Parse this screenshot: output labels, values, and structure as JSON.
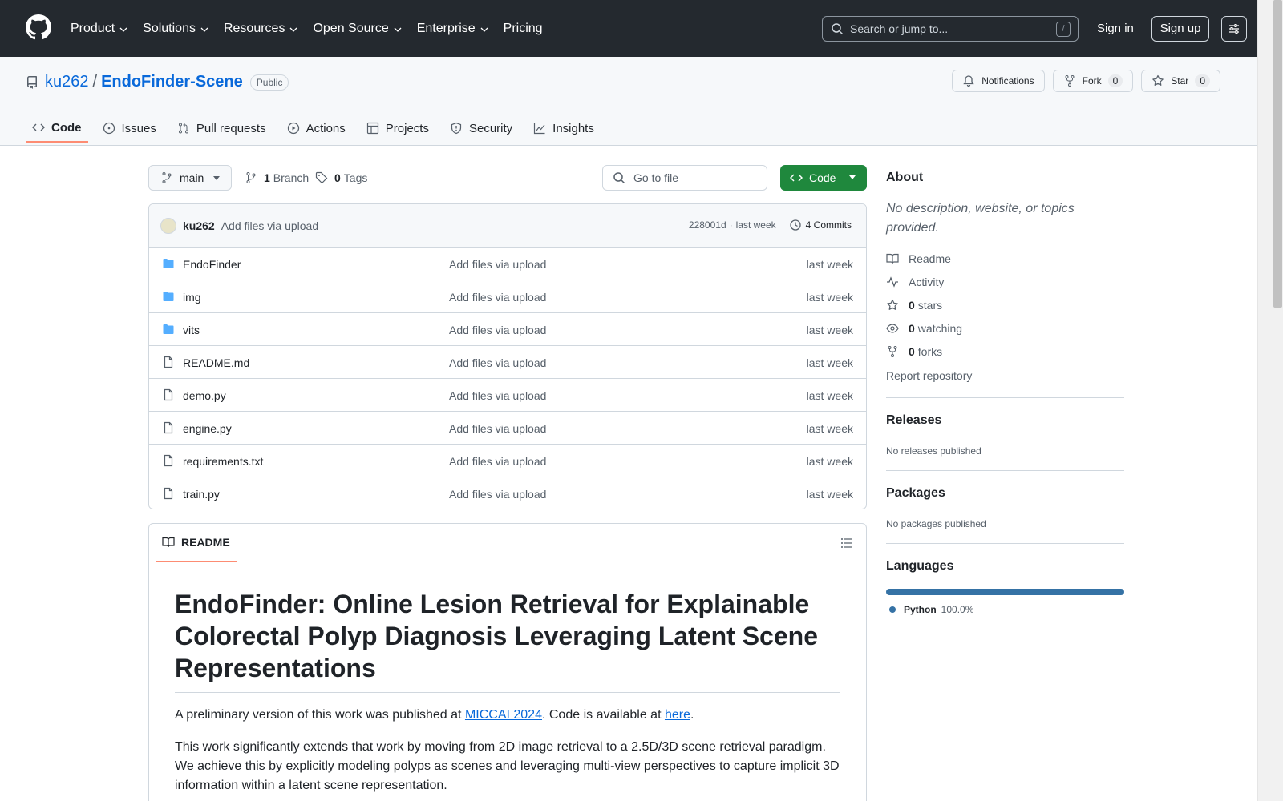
{
  "header": {
    "nav": [
      {
        "label": "Product",
        "has_caret": true
      },
      {
        "label": "Solutions",
        "has_caret": true
      },
      {
        "label": "Resources",
        "has_caret": true
      },
      {
        "label": "Open Source",
        "has_caret": true
      },
      {
        "label": "Enterprise",
        "has_caret": true
      },
      {
        "label": "Pricing",
        "has_caret": false
      }
    ],
    "search_placeholder": "Search or jump to...",
    "search_shortcut": "/",
    "signin": "Sign in",
    "signup": "Sign up"
  },
  "repo": {
    "owner": "ku262",
    "separator": "/",
    "name": "EndoFinder-Scene",
    "visibility": "Public",
    "notifications": "Notifications",
    "fork_label": "Fork",
    "fork_count": "0",
    "star_label": "Star",
    "star_count": "0"
  },
  "tabs": [
    {
      "label": "Code",
      "icon": "code-icon",
      "active": true
    },
    {
      "label": "Issues",
      "icon": "issue-icon",
      "active": false
    },
    {
      "label": "Pull requests",
      "icon": "pull-request-icon",
      "active": false
    },
    {
      "label": "Actions",
      "icon": "play-icon",
      "active": false
    },
    {
      "label": "Projects",
      "icon": "table-icon",
      "active": false
    },
    {
      "label": "Security",
      "icon": "shield-icon",
      "active": false
    },
    {
      "label": "Insights",
      "icon": "graph-icon",
      "active": false
    }
  ],
  "toolbar": {
    "branch": "main",
    "branch_count": "1",
    "branch_label": "Branch",
    "tag_count": "0",
    "tag_label": "Tags",
    "goto_placeholder": "Go to file",
    "code_button": "Code"
  },
  "commit": {
    "author": "ku262",
    "message": "Add files via upload",
    "hash": "228001d",
    "dot": "·",
    "time": "last week",
    "commits": "4 Commits"
  },
  "files": [
    {
      "name": "EndoFinder",
      "type": "dir",
      "message": "Add files via upload",
      "date": "last week"
    },
    {
      "name": "img",
      "type": "dir",
      "message": "Add files via upload",
      "date": "last week"
    },
    {
      "name": "vits",
      "type": "dir",
      "message": "Add files via upload",
      "date": "last week"
    },
    {
      "name": "README.md",
      "type": "file",
      "message": "Add files via upload",
      "date": "last week"
    },
    {
      "name": "demo.py",
      "type": "file",
      "message": "Add files via upload",
      "date": "last week"
    },
    {
      "name": "engine.py",
      "type": "file",
      "message": "Add files via upload",
      "date": "last week"
    },
    {
      "name": "requirements.txt",
      "type": "file",
      "message": "Add files via upload",
      "date": "last week"
    },
    {
      "name": "train.py",
      "type": "file",
      "message": "Add files via upload",
      "date": "last week"
    }
  ],
  "readme": {
    "tab": "README",
    "title": "EndoFinder: Online Lesion Retrieval for Explainable Colorectal Polyp Diagnosis Leveraging Latent Scene Representations",
    "p1_before": "A preliminary version of this work was published at ",
    "p1_link1": "MICCAI 2024",
    "p1_middle": ". Code is available at ",
    "p1_link2": "here",
    "p1_after": ".",
    "p2": "This work significantly extends that work by moving from 2D image retrieval to a 2.5D/3D scene retrieval paradigm. We achieve this by explicitly modeling polyps as scenes and leveraging multi-view perspectives to capture implicit 3D information within a latent scene representation."
  },
  "sidebar": {
    "about_title": "About",
    "about_desc": "No description, website, or topics provided.",
    "readme": "Readme",
    "activity": "Activity",
    "stars_count": "0",
    "stars_label": "stars",
    "watching_count": "0",
    "watching_label": "watching",
    "forks_count": "0",
    "forks_label": "forks",
    "report": "Report repository",
    "releases_title": "Releases",
    "releases_text": "No releases published",
    "packages_title": "Packages",
    "packages_text": "No packages published",
    "languages_title": "Languages",
    "languages": [
      {
        "name": "Python",
        "percent": "100.0%",
        "color": "#3572A5",
        "fraction": 1.0
      }
    ]
  },
  "colors": {
    "header_bg": "#24292f",
    "accent_link": "#0969da",
    "code_button": "#1f883d",
    "active_tab_underline": "#fd8c73"
  }
}
